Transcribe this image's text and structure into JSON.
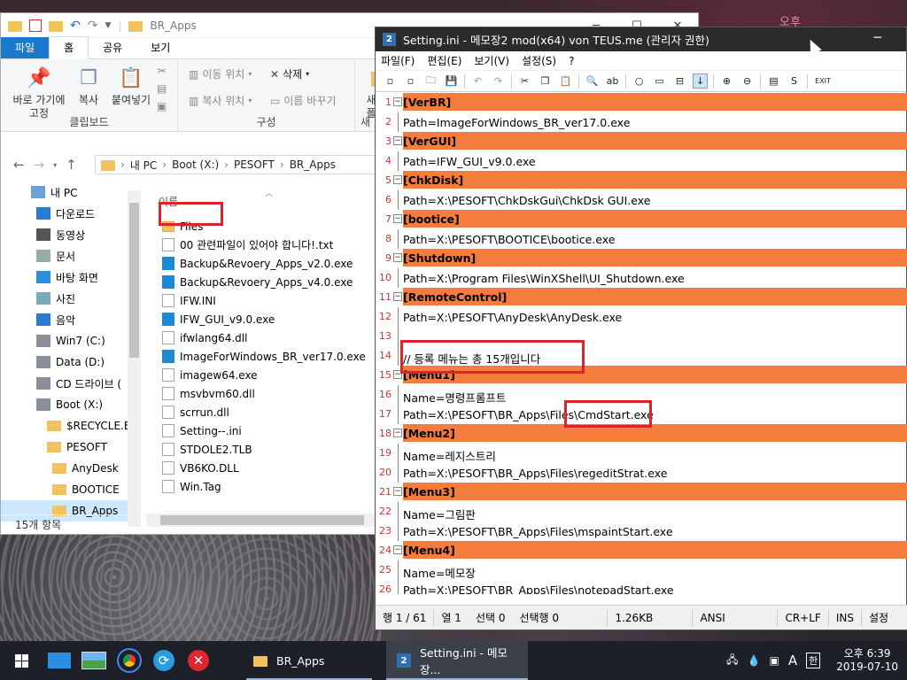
{
  "desktop": {
    "pink_text": "오후"
  },
  "explorer": {
    "title": "BR_Apps",
    "tabs": {
      "file": "파일",
      "home": "홈",
      "share": "공유",
      "view": "보기"
    },
    "ribbon": {
      "pin_label": "바로 가기에\n고정",
      "copy": "복사",
      "paste": "붙여넣기",
      "clipboard_group": "클립보드",
      "move_to": "이동 위치",
      "delete": "삭제",
      "copy_to": "복사 위치",
      "rename": "이름 바꾸기",
      "organize_group": "구성",
      "new_partial": "새",
      "new2": "새",
      "new3": "폴"
    },
    "address": [
      "내 PC",
      "Boot (X:)",
      "PESOFT",
      "BR_Apps"
    ],
    "column_name": "이름",
    "nav_items": [
      {
        "label": "내 PC",
        "icon": "pc-icon"
      },
      {
        "label": "다운로드",
        "icon": "download-icon"
      },
      {
        "label": "동영상",
        "icon": "video-icon"
      },
      {
        "label": "문서",
        "icon": "document-icon"
      },
      {
        "label": "바탕 화면",
        "icon": "desktop-icon"
      },
      {
        "label": "사진",
        "icon": "picture-icon"
      },
      {
        "label": "음악",
        "icon": "music-icon"
      },
      {
        "label": "Win7 (C:)",
        "icon": "drive-icon"
      },
      {
        "label": "Data (D:)",
        "icon": "drive-icon"
      },
      {
        "label": "CD 드라이브 (",
        "icon": "cd-drive-icon"
      },
      {
        "label": "Boot (X:)",
        "icon": "drive-icon"
      },
      {
        "label": "$RECYCLE.BI",
        "icon": "folder-icon"
      },
      {
        "label": "PESOFT",
        "icon": "folder-icon"
      },
      {
        "label": "AnyDesk",
        "icon": "folder-icon"
      },
      {
        "label": "BOOTICE",
        "icon": "folder-icon"
      },
      {
        "label": "BR_Apps",
        "icon": "folder-icon"
      }
    ],
    "files": [
      {
        "name": "Files",
        "type": "folder"
      },
      {
        "name": "00 관련파일이 있어야 합니다!.txt",
        "type": "txt"
      },
      {
        "name": "Backup&Revoery_Apps_v2.0.exe",
        "type": "exe"
      },
      {
        "name": "Backup&Revoery_Apps_v4.0.exe",
        "type": "exe"
      },
      {
        "name": "IFW.INI",
        "type": "ini"
      },
      {
        "name": "IFW_GUI_v9.0.exe",
        "type": "exe"
      },
      {
        "name": "ifwlang64.dll",
        "type": "dll"
      },
      {
        "name": "ImageForWindows_BR_ver17.0.exe",
        "type": "exe"
      },
      {
        "name": "imagew64.exe",
        "type": "exe2"
      },
      {
        "name": "msvbvm60.dll",
        "type": "dll"
      },
      {
        "name": "scrrun.dll",
        "type": "dll"
      },
      {
        "name": "Setting--.ini",
        "type": "ini"
      },
      {
        "name": "STDOLE2.TLB",
        "type": "file"
      },
      {
        "name": "VB6KO.DLL",
        "type": "dll"
      },
      {
        "name": "Win.Tag",
        "type": "file"
      }
    ],
    "status": "15개 항목"
  },
  "notepad": {
    "title": "Setting.ini - 메모장2 mod(x64) von TEUS.me (관리자 권한)",
    "logo": "2",
    "menu": [
      "파일(F)",
      "편집(E)",
      "보기(V)",
      "설정(S)",
      "?"
    ],
    "toolbar_exit": "EXIT",
    "toolbar_s": "S",
    "lines": [
      {
        "n": "1",
        "t": "[VerBR]",
        "sec": true
      },
      {
        "n": "2",
        "t": "Path=ImageForWindows_BR_ver17.0.exe",
        "sec": false
      },
      {
        "n": "3",
        "t": "[VerGUI]",
        "sec": true
      },
      {
        "n": "4",
        "t": "Path=IFW_GUI_v9.0.exe",
        "sec": false
      },
      {
        "n": "5",
        "t": "[ChkDisk]",
        "sec": true
      },
      {
        "n": "6",
        "t": "Path=X:\\PESOFT\\ChkDskGui\\ChkDsk GUI.exe",
        "sec": false
      },
      {
        "n": "7",
        "t": "[bootice]",
        "sec": true
      },
      {
        "n": "8",
        "t": "Path=X:\\PESOFT\\BOOTICE\\bootice.exe",
        "sec": false
      },
      {
        "n": "9",
        "t": "[Shutdown]",
        "sec": true
      },
      {
        "n": "10",
        "t": "Path=X:\\Program Files\\WinXShell\\UI_Shutdown.exe",
        "sec": false
      },
      {
        "n": "11",
        "t": "[RemoteControl]",
        "sec": true
      },
      {
        "n": "12",
        "t": "Path=X:\\PESOFT\\AnyDesk\\AnyDesk.exe",
        "sec": false
      },
      {
        "n": "13",
        "t": "",
        "sec": false
      },
      {
        "n": "14",
        "t": "// 등록 메뉴는 총 15개입니다",
        "sec": false
      },
      {
        "n": "15",
        "t": "[Menu1]",
        "sec": true
      },
      {
        "n": "16",
        "t": "Name=명령프롬프트",
        "sec": false
      },
      {
        "n": "17",
        "t": "Path=X:\\PESOFT\\BR_Apps\\Files\\CmdStart.exe",
        "sec": false
      },
      {
        "n": "18",
        "t": "[Menu2]",
        "sec": true
      },
      {
        "n": "19",
        "t": "Name=레지스트리",
        "sec": false
      },
      {
        "n": "20",
        "t": "Path=X:\\PESOFT\\BR_Apps\\Files\\regeditStrat.exe",
        "sec": false
      },
      {
        "n": "21",
        "t": "[Menu3]",
        "sec": true
      },
      {
        "n": "22",
        "t": "Name=그림판",
        "sec": false
      },
      {
        "n": "23",
        "t": "Path=X:\\PESOFT\\BR_Apps\\Files\\mspaintStart.exe",
        "sec": false
      },
      {
        "n": "24",
        "t": "[Menu4]",
        "sec": true
      },
      {
        "n": "25",
        "t": "Name=메모장",
        "sec": false
      },
      {
        "n": "26",
        "t": "Path=X:\\PESOFT\\BR_Apps\\Files\\notepadStart.exe",
        "sec": false
      }
    ],
    "status": {
      "line": "행 1 / 61",
      "col": "열 1",
      "sel": "선택 0",
      "selrow": "선택행 0",
      "size": "1.26KB",
      "enc": "ANSI",
      "eol": "CR+LF",
      "mode": "INS",
      "settings": "설정"
    },
    "section_color": "#f47c3c"
  },
  "taskbar": {
    "apps": [
      {
        "label": "BR_Apps"
      },
      {
        "label": "Setting.ini - 메모장..."
      }
    ],
    "ime": "A",
    "ime2": "한",
    "time": "오후 6:39",
    "date": "2019-07-10"
  }
}
